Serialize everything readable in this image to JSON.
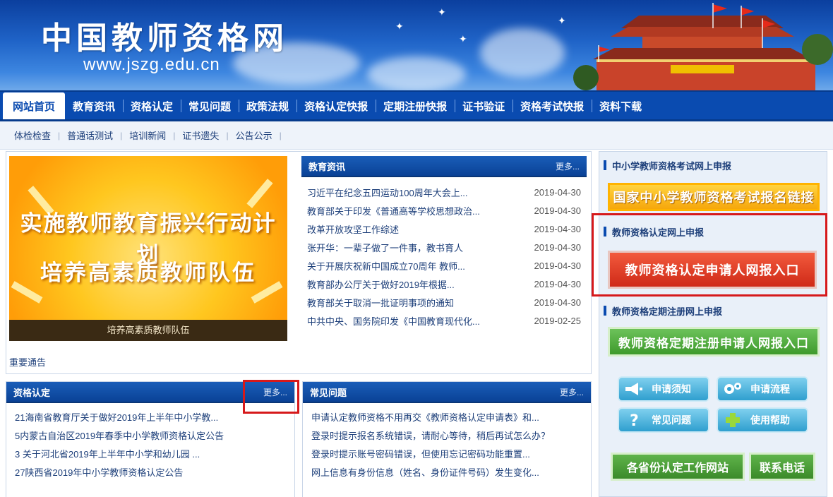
{
  "site": {
    "title": "中国教师资格网",
    "url": "www.jszg.edu.cn"
  },
  "nav": {
    "items": [
      "网站首页",
      "教育资讯",
      "资格认定",
      "常见问题",
      "政策法规",
      "资格认定快报",
      "定期注册快报",
      "证书验证",
      "资格考试快报",
      "资料下载"
    ]
  },
  "subnav": {
    "items": [
      "体检检查",
      "普通话测试",
      "培训新闻",
      "证书遗失",
      "公告公示"
    ]
  },
  "feature": {
    "line1": "实施教师教育振兴行动计划",
    "line2": "培养高素质教师队伍",
    "caption": "培养高素质教师队伍"
  },
  "notice_label": "重要通告",
  "news": {
    "title": "教育资讯",
    "more": "更多...",
    "items": [
      {
        "title": "习近平在纪念五四运动100周年大会上...",
        "date": "2019-04-30"
      },
      {
        "title": "教育部关于印发《普通高等学校思想政治...",
        "date": "2019-04-30"
      },
      {
        "title": "改革开放攻坚工作综述",
        "date": "2019-04-30"
      },
      {
        "title": "张开华：一辈子做了一件事，教书育人",
        "date": "2019-04-30"
      },
      {
        "title": "关于开展庆祝新中国成立70周年 教师...",
        "date": "2019-04-30"
      },
      {
        "title": "教育部办公厅关于做好2019年根据...",
        "date": "2019-04-30"
      },
      {
        "title": "教育部关于取消一批证明事项的通知",
        "date": "2019-04-30"
      },
      {
        "title": "中共中央、国务院印发《中国教育现代化...",
        "date": "2019-02-25"
      }
    ]
  },
  "qualification": {
    "title": "资格认定",
    "more": "更多...",
    "items": [
      "21海南省教育厅关于做好2019年上半年中小学教...",
      "5内蒙古自治区2019年春季中小学教师资格认定公告",
      "3 关于河北省2019年上半年中小学和幼儿园 ...",
      "27陕西省2019年中小学教师资格认定公告"
    ]
  },
  "faq": {
    "title": "常见问题",
    "more": "更多...",
    "items": [
      "申请认定教师资格不用再交《教师资格认定申请表》和...",
      "登录时提示报名系统错误，请耐心等待，稍后再试怎么办？",
      "登录时提示账号密码错误，但使用忘记密码功能重置...",
      "网上信息有身份信息（姓名、身份证件号码）发生变化..."
    ]
  },
  "right": {
    "exam_head": "中小学教师资格考试网上申报",
    "exam_button": "国家中小学教师资格考试报名链接",
    "cert_head": "教师资格认定网上申报",
    "cert_button": "教师资格认定申请人网报入口",
    "reg_head": "教师资格定期注册网上申报",
    "reg_button": "教师资格定期注册申请人网报入口",
    "icon_buttons": [
      {
        "label": "申请须知",
        "icon": "megaphone-icon"
      },
      {
        "label": "申请流程",
        "icon": "gears-icon"
      },
      {
        "label": "常见问题",
        "icon": "question-icon"
      },
      {
        "label": "使用帮助",
        "icon": "plus-icon"
      }
    ],
    "bottom_left": "各省份认定工作网站",
    "bottom_right": "联系电话"
  },
  "colors": {
    "nav_bg": "#0a4bb0",
    "highlight_red": "#d6191b",
    "cert_button": "#cf2a18",
    "reg_button": "#3e9a2c",
    "exam_button": "#f6a70c"
  }
}
